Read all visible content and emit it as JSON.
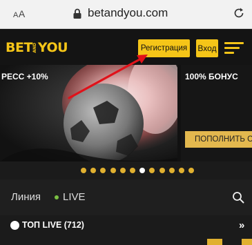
{
  "browser": {
    "text_size_label_small": "A",
    "text_size_label_large": "A",
    "url": "betandyou.com"
  },
  "header": {
    "logo_left": "BET",
    "logo_mid": "AND",
    "logo_right": "YOU",
    "register_label": "Регистрация",
    "login_label": "Вход",
    "accent_color": "#f5c518"
  },
  "banner": {
    "slide_left_promo": "РЕСС +10%",
    "slide_right_promo": "100% БОНУС",
    "slide_right_button": "ПОПОЛНИТЬ СЧ"
  },
  "carousel": {
    "total": 12,
    "active_index": 6
  },
  "tabs": {
    "line_label": "Линия",
    "live_label": "LIVE"
  },
  "top_live": {
    "label": "ТОП LIVE (712)",
    "more_label": "»"
  }
}
